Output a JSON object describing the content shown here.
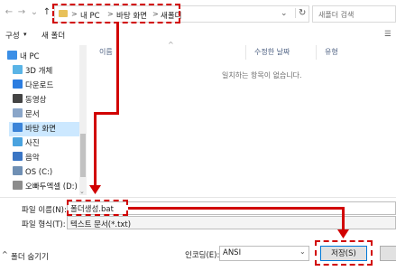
{
  "nav": {
    "back_glyph": "←",
    "forward_glyph": "→",
    "down_glyph": "⌄",
    "up_glyph": "↑"
  },
  "address": {
    "crumbs": [
      "내 PC",
      "바탕 화면",
      "새폴더"
    ],
    "separator": ">",
    "dropdown_glyph": "⌄",
    "refresh_glyph": "↻"
  },
  "search": {
    "placeholder": "새폴더 검색",
    "icon": "search-icon"
  },
  "toolbar": {
    "organize": "구성",
    "organize_arrow": "▾",
    "new_folder": "새 폴더",
    "view_glyph": "☰"
  },
  "sidebar": {
    "items": [
      {
        "label": "내 PC",
        "icon": "pc-icon",
        "color": "#3a8ee6"
      },
      {
        "label": "3D 개체",
        "icon": "cube-icon",
        "color": "#5ab4e6"
      },
      {
        "label": "다운로드",
        "icon": "download-icon",
        "color": "#2c7de0"
      },
      {
        "label": "동영상",
        "icon": "video-icon",
        "color": "#444444"
      },
      {
        "label": "문서",
        "icon": "document-icon",
        "color": "#8aa6c9"
      },
      {
        "label": "바탕 화면",
        "icon": "desktop-icon",
        "color": "#3b84d8",
        "selected": true
      },
      {
        "label": "사진",
        "icon": "picture-icon",
        "color": "#4aa3df"
      },
      {
        "label": "음악",
        "icon": "music-icon",
        "color": "#3a75c4"
      },
      {
        "label": "OS (C:)",
        "icon": "drive-icon",
        "color": "#6f8fb4"
      },
      {
        "label": "오빠두엑셀 (D:)",
        "icon": "drive-icon",
        "color": "#8c8c8c"
      }
    ]
  },
  "columns": {
    "name": "이름",
    "sort_glyph": "^",
    "modified": "수정한 날짜",
    "type": "유형"
  },
  "empty_message": "일치하는 항목이 없습니다.",
  "filename": {
    "label": "파일 이름(N):",
    "value": "폴더생성.bat"
  },
  "filetype": {
    "label": "파일 형식(T):",
    "value": "텍스트 문서(*.txt)"
  },
  "hide_folders": {
    "label": "폴더 숨기기",
    "glyph": "^"
  },
  "encoding": {
    "label": "인코딩(E):",
    "value": "ANSI"
  },
  "save_button": {
    "label": "저장(S)"
  },
  "colors": {
    "annotation_red": "#d10000",
    "selection_blue": "#cce8ff",
    "header_blue": "#4d6082"
  }
}
